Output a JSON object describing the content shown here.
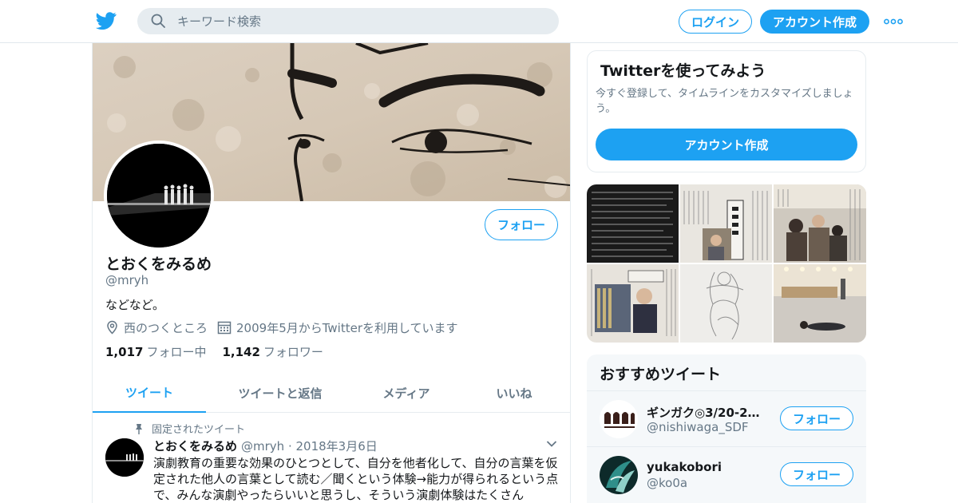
{
  "header": {
    "search_placeholder": "キーワード検索",
    "login_label": "ログイン",
    "signup_label": "アカウント作成"
  },
  "profile": {
    "name": "とおくをみるめ",
    "handle": "@mryh",
    "bio": "などなど。",
    "location": "西のつくところ",
    "joined": "2009年5月からTwitterを利用しています",
    "following_count": "1,017",
    "following_label": "フォロー中",
    "followers_count": "1,142",
    "followers_label": "フォロワー",
    "follow_label": "フォロー"
  },
  "tabs": [
    {
      "label": "ツイート",
      "active": true
    },
    {
      "label": "ツイートと返信",
      "active": false
    },
    {
      "label": "メディア",
      "active": false
    },
    {
      "label": "いいね",
      "active": false
    }
  ],
  "pinned_tweet": {
    "pinned_label": "固定されたツイート",
    "author_name": "とおくをみるめ",
    "meta": "@mryh · 2018年3月6日",
    "text": "演劇教育の重要な効果のひとつとして、自分を他者化して、自分の言葉を仮定された他人の言葉として読む／聞くという体験→能力が得られるという点で、みんな演劇やったらいいと思うし、そういう演劇体験はたくさん"
  },
  "signup_card": {
    "title": "Twitterを使ってみよう",
    "description": "今すぐ登録して、タイムラインをカスタマイズしましょう。",
    "cta_label": "アカウント作成"
  },
  "recommended": {
    "title": "おすすめツイート",
    "accounts": [
      {
        "name": "ギンガク◎3/20-22 …",
        "handle": "@nishiwaga_SDF",
        "follow_label": "フォロー"
      },
      {
        "name": "yukakobori",
        "handle": "@ko0a",
        "follow_label": "フォロー"
      }
    ]
  },
  "colors": {
    "accent": "#1da1f2",
    "text_primary": "#14171a",
    "text_secondary": "#657786"
  },
  "icons": [
    "twitter-bird-icon",
    "search-icon",
    "more-dots-icon",
    "location-pin-icon",
    "calendar-icon",
    "pin-icon",
    "chevron-down-icon"
  ]
}
